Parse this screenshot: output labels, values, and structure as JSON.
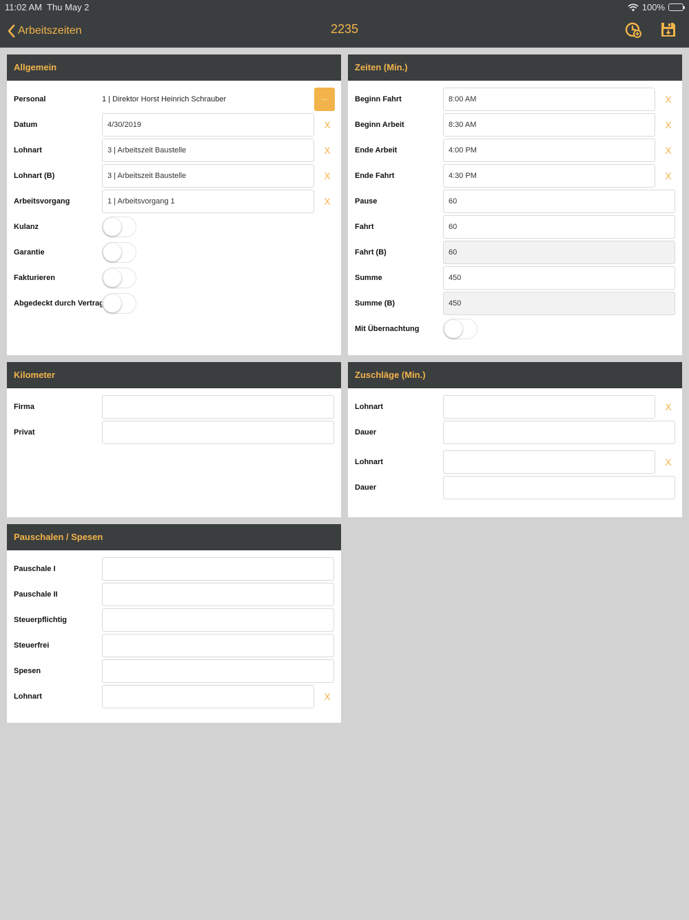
{
  "status": {
    "time": "11:02 AM",
    "date": "Thu May 2",
    "battery": "100%"
  },
  "nav": {
    "back_label": "Arbeitszeiten",
    "title": "2235"
  },
  "allgemein": {
    "header": "Allgemein",
    "personal_label": "Personal",
    "personal_value": "1 | Direktor Horst Heinrich Schrauber",
    "personal_button": "...",
    "datum_label": "Datum",
    "datum_value": "4/30/2019",
    "lohnart_label": "Lohnart",
    "lohnart_value": "3 | Arbeitszeit Baustelle",
    "lohnart_b_label": "Lohnart (B)",
    "lohnart_b_value": "3 | Arbeitszeit Baustelle",
    "arbeitsvorgang_label": "Arbeitsvorgang",
    "arbeitsvorgang_value": "1 | Arbeitsvorgang 1",
    "kulanz_label": "Kulanz",
    "garantie_label": "Garantie",
    "fakturieren_label": "Fakturieren",
    "vertrag_label": "Abgedeckt durch Vertrag",
    "clear": "X"
  },
  "zeiten": {
    "header": "Zeiten (Min.)",
    "beginn_fahrt_label": "Beginn Fahrt",
    "beginn_fahrt_value": "8:00 AM",
    "beginn_arbeit_label": "Beginn Arbeit",
    "beginn_arbeit_value": "8:30 AM",
    "ende_arbeit_label": "Ende Arbeit",
    "ende_arbeit_value": "4:00 PM",
    "ende_fahrt_label": "Ende Fahrt",
    "ende_fahrt_value": "4:30 PM",
    "pause_label": "Pause",
    "pause_value": "60",
    "fahrt_label": "Fahrt",
    "fahrt_value": "60",
    "fahrt_b_label": "Fahrt (B)",
    "fahrt_b_value": "60",
    "summe_label": "Summe",
    "summe_value": "450",
    "summe_b_label": "Summe (B)",
    "summe_b_value": "450",
    "uebernachtung_label": "Mit Übernachtung",
    "clear": "X"
  },
  "kilometer": {
    "header": "Kilometer",
    "firma_label": "Firma",
    "privat_label": "Privat"
  },
  "zuschlaege": {
    "header": "Zuschläge (Min.)",
    "lohnart1_label": "Lohnart",
    "dauer1_label": "Dauer",
    "lohnart2_label": "Lohnart",
    "dauer2_label": "Dauer",
    "clear": "X"
  },
  "pauschalen": {
    "header": "Pauschalen / Spesen",
    "pauschale1_label": "Pauschale I",
    "pauschale2_label": "Pauschale II",
    "steuerpflichtig_label": "Steuerpflichtig",
    "steuerfrei_label": "Steuerfrei",
    "spesen_label": "Spesen",
    "lohnart_label": "Lohnart",
    "clear": "X"
  }
}
